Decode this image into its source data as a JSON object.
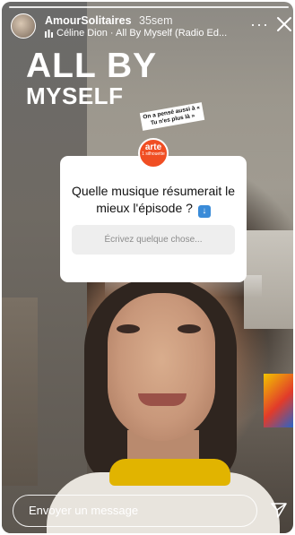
{
  "story": {
    "username": "AmourSolitaires",
    "time_ago": "35sem",
    "music_label": "Céline Dion · All By Myself (Radio Ed...",
    "music_icon": "music-bars-icon",
    "title_line1": "ALL BY",
    "title_line2": "MYSELF",
    "sticker_text": "On a pensé aussi à « Tu n'es plus là »",
    "logo_text": "arte",
    "logo_subtext": "1 silhouette"
  },
  "question_card": {
    "question": "Quelle musique résumerait le mieux l'épisode ?",
    "question_emoji_icon": "arrow-down-box-icon",
    "answer_placeholder": "Écrivez quelque chose..."
  },
  "reply_bar": {
    "placeholder": "Envoyer un message",
    "send_icon": "send-icon"
  },
  "colors": {
    "arte_orange": "#f04e23",
    "card_white": "#ffffff",
    "answer_box": "#eeeeee"
  }
}
